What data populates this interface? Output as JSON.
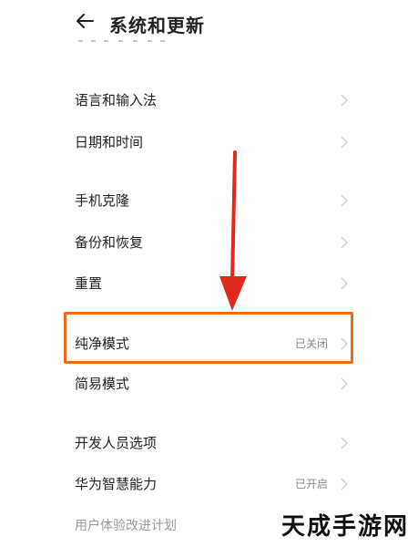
{
  "header": {
    "title": "系统和更新",
    "back_icon": "arrow-left-icon"
  },
  "settings": {
    "items": [
      {
        "label": "语言和输入法",
        "value": ""
      },
      {
        "label": "日期和时间",
        "value": ""
      },
      {
        "label": "手机克隆",
        "value": ""
      },
      {
        "label": "备份和恢复",
        "value": ""
      },
      {
        "label": "重置",
        "value": ""
      },
      {
        "label": "纯净模式",
        "value": "已关闭"
      },
      {
        "label": "简易模式",
        "value": ""
      },
      {
        "label": "开发人员选项",
        "value": ""
      },
      {
        "label": "华为智慧能力",
        "value": "已开启"
      },
      {
        "label": "用户体验改进计划",
        "value": ""
      }
    ]
  },
  "annotation": {
    "arrow_color": "#e02a1e",
    "box_color": "#f06a12"
  },
  "watermark": "天成手游网"
}
